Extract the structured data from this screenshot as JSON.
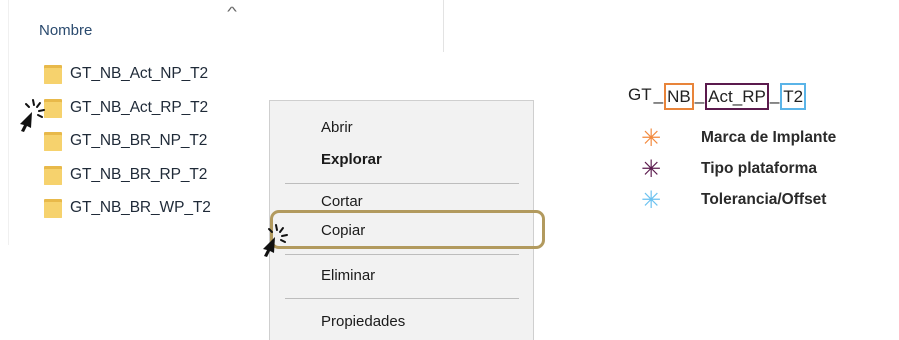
{
  "explorer": {
    "column_header": "Nombre",
    "sort_indicator": "^",
    "files": [
      "GT_NB_Act_NP_T2",
      "GT_NB_Act_RP_T2",
      "GT_NB_BR_NP_T2",
      "GT_NB_BR_RP_T2",
      "GT_NB_BR_WP_T2"
    ]
  },
  "context_menu": {
    "items": [
      "Abrir",
      "Explorar",
      "Cortar",
      "Copiar",
      "Eliminar",
      "Propiedades"
    ],
    "bold_item": "Explorar",
    "highlighted_item": "Copiar"
  },
  "naming_legend": {
    "segments": [
      {
        "text": "GT",
        "boxed": false,
        "color": ""
      },
      {
        "text": "NB",
        "boxed": true,
        "color": "#e8843a"
      },
      {
        "text": "Act_RP",
        "boxed": true,
        "color": "#5b1a4d"
      },
      {
        "text": "T2",
        "boxed": true,
        "color": "#5ab4e8"
      }
    ],
    "separators": [
      "_",
      "_",
      "_"
    ],
    "entries": [
      {
        "symbol": "✳",
        "color": "#f28a3e",
        "label": "Marca de Implante"
      },
      {
        "symbol": "✳",
        "color": "#5b1a4d",
        "label": "Tipo plataforma"
      },
      {
        "symbol": "✳",
        "color": "#6cc2f0",
        "label": "Tolerancia/Offset"
      }
    ]
  },
  "colors": {
    "highlight_border": "#b29a5e",
    "menu_background": "#f2f2f2",
    "folder_yellow": "#f6d26d"
  }
}
